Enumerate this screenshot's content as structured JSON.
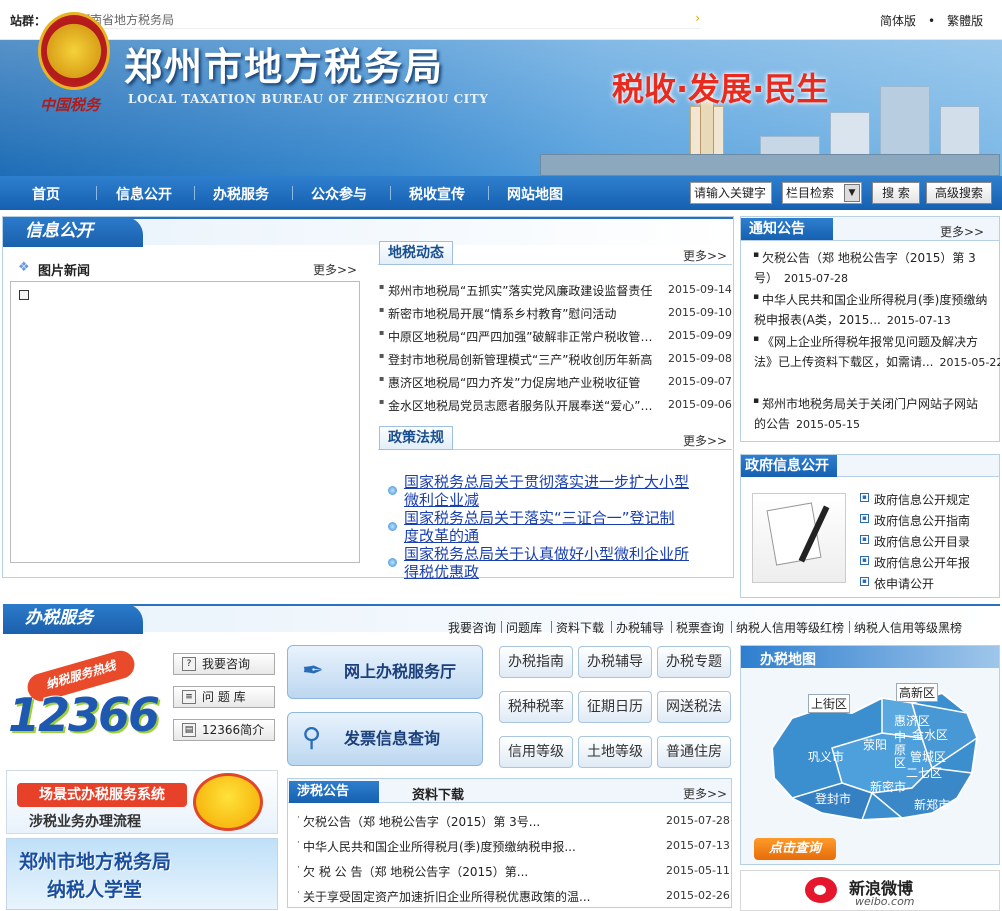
{
  "topbar": {
    "site_label": "站群：",
    "site_value": "河南省地方税务局",
    "lang_simplified": "简体版",
    "lang_dot": "•",
    "lang_traditional": "繁體版"
  },
  "banner": {
    "title_cn": "郑州市地方税务局",
    "title_en": "LOCAL TAXATION BUREAU OF ZHENGZHOU CITY",
    "emblem_text": "中国税务",
    "slogan": "税收·发展·民生"
  },
  "nav": {
    "items": [
      "首页",
      "信息公开",
      "办税服务",
      "公众参与",
      "税收宣传",
      "网站地图"
    ],
    "search_placeholder": "请输入关键字",
    "column_select": "栏目检索",
    "search_btn": "搜 索",
    "advanced_btn": "高级搜索"
  },
  "info": {
    "section_title": "信息公开",
    "photo_title": "图片新闻",
    "more": "更多>>",
    "news_tab": "地税动态",
    "news": [
      {
        "t": "郑州市地税局“五抓实”落实党风廉政建设监督责任",
        "d": "2015-09-14"
      },
      {
        "t": "新密市地税局开展“情系乡村教育”慰问活动",
        "d": "2015-09-10"
      },
      {
        "t": "中原区地税局“四严四加强”破解非正常户税收管理难题",
        "d": "2015-09-09"
      },
      {
        "t": "登封市地税局创新管理模式“三产”税收创历年新高",
        "d": "2015-09-08"
      },
      {
        "t": "惠济区地税局“四力齐发”力促房地产业税收征管",
        "d": "2015-09-07"
      },
      {
        "t": "金水区地税局党员志愿者服务队开展奉送“爱心”活动",
        "d": "2015-09-06"
      }
    ],
    "policy_tab": "政策法规",
    "policies": [
      {
        "l1": "国家税务总局关于贯彻落实进一步扩大小型",
        "l2": "微利企业减"
      },
      {
        "l1": "国家税务总局关于落实“三证合一”登记制",
        "l2": "度改革的通"
      },
      {
        "l1": "国家税务总局关于认真做好小型微利企业所",
        "l2": "得税优惠政"
      }
    ]
  },
  "notice": {
    "title": "通知公告",
    "more": "更多>>",
    "items": [
      {
        "l1": "欠税公告（郑 地税公告字（2015）第 3",
        "l2": "号）",
        "d": "2015-07-28"
      },
      {
        "l1": "中华人民共和国企业所得税月(季)度预缴纳",
        "l2": "税申报表(A类，2015...",
        "d": "2015-07-13"
      },
      {
        "l1": "《网上企业所得税年报常见问题及解决方",
        "l2": "法》已上传资料下载区，如需请...",
        "d": "2015-05-22"
      },
      {
        "l1": "郑州市地税务局关于关闭门户网站子网站",
        "l2": "的公告",
        "d": "2015-05-15"
      }
    ]
  },
  "gov": {
    "title": "政府信息公开",
    "items": [
      "政府信息公开规定",
      "政府信息公开指南",
      "政府信息公开目录",
      "政府信息公开年报",
      "依申请公开"
    ]
  },
  "service": {
    "section_title": "办税服务",
    "links": [
      "我要咨询",
      "问题库",
      "资料下载",
      "办税辅导",
      "税票查询",
      "纳税人信用等级红榜",
      "纳税人信用等级黑榜"
    ],
    "hotline": "纳税服务热线",
    "hotline_num": "12366",
    "small_btns": [
      "我要咨询",
      "问 题 库",
      "12366简介"
    ],
    "big_btns": [
      "网上办税服务厅",
      "发票信息查询"
    ],
    "grid": [
      "办税指南",
      "办税辅导",
      "办税专题",
      "税种税率",
      "征期日历",
      "网送税法",
      "信用等级",
      "土地等级",
      "普通住房"
    ],
    "promo1_title": "场景式办税服务系统",
    "promo1_sub": "涉税业务办理流程",
    "promo2_l1": "郑州市地方税务局",
    "promo2_l2": "纳税人学堂",
    "tab1": "涉税公告",
    "tab2": "资料下载",
    "more": "更多>>",
    "notices": [
      {
        "t": "欠税公告（郑 地税公告字（2015）第 3号...",
        "d": "2015-07-28"
      },
      {
        "t": "中华人民共和国企业所得税月(季)度预缴纳税申报...",
        "d": "2015-07-13"
      },
      {
        "t": "欠 税 公 告（郑 地税公告字（2015）第...",
        "d": "2015-05-11"
      },
      {
        "t": "关于享受固定资产加速折旧企业所得税优惠政策的温...",
        "d": "2015-02-26"
      }
    ]
  },
  "map": {
    "title": "办税地图",
    "regions": [
      "上街区",
      "高新区",
      "惠济区",
      "金水区",
      "巩义市",
      "荥阳",
      "中原区",
      "管城区",
      "二七区",
      "新密市",
      "登封市",
      "新郑市"
    ],
    "query_btn": "点击查询"
  },
  "weibo": {
    "name": "新浪微博",
    "url": "weibo.com"
  }
}
